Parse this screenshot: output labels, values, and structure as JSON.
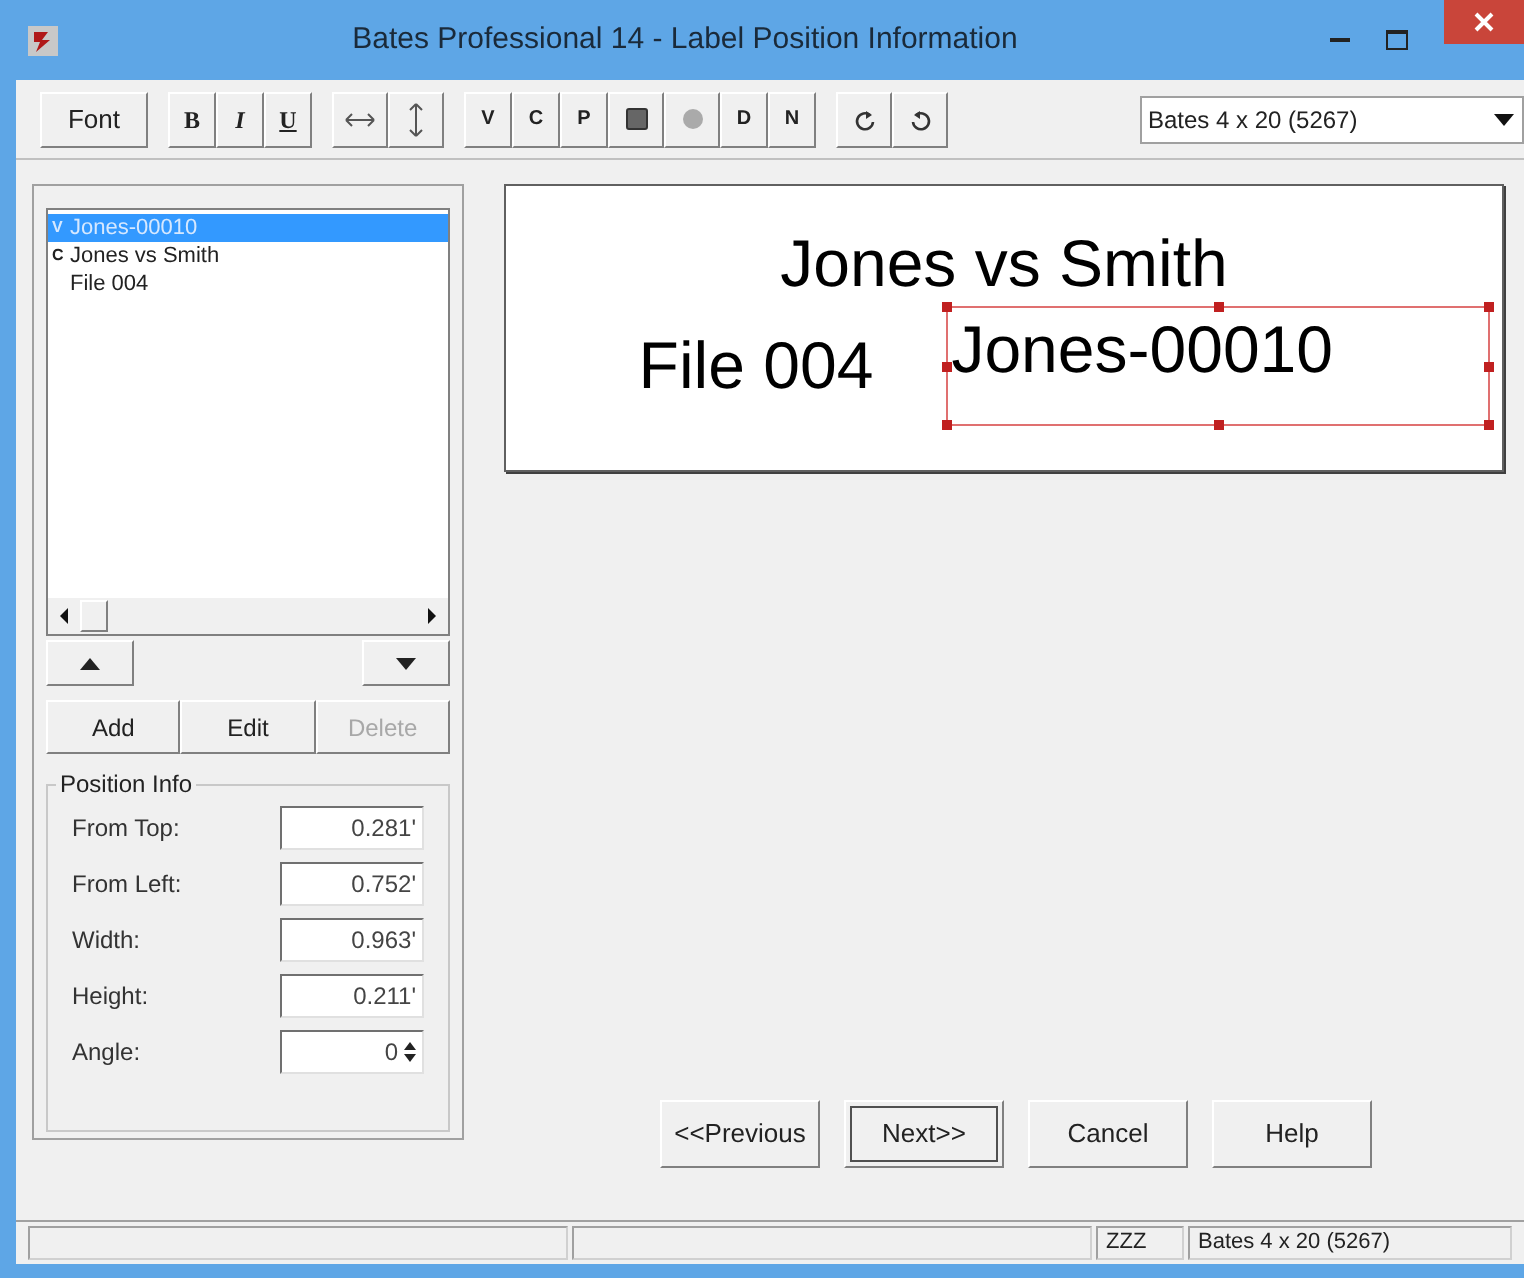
{
  "window": {
    "title": "Bates Professional 14 - Label Position Information"
  },
  "toolbar": {
    "groups": [
      {
        "buttons": [
          {
            "kind": "text",
            "label": "Font"
          }
        ]
      },
      {
        "buttons": [
          {
            "kind": "text",
            "label": "B"
          },
          {
            "kind": "text",
            "label": "I"
          },
          {
            "kind": "text",
            "label": "U"
          }
        ]
      },
      {
        "buttons": [
          {
            "kind": "hresize"
          },
          {
            "kind": "vresize"
          }
        ]
      },
      {
        "buttons": [
          {
            "kind": "text",
            "label": "V"
          },
          {
            "kind": "text",
            "label": "C"
          },
          {
            "kind": "text",
            "label": "P"
          },
          {
            "kind": "square"
          },
          {
            "kind": "dot"
          },
          {
            "kind": "text",
            "label": "D"
          },
          {
            "kind": "text",
            "label": "N"
          }
        ]
      },
      {
        "buttons": [
          {
            "kind": "redo"
          },
          {
            "kind": "undo"
          }
        ]
      }
    ],
    "dropdown": {
      "value": "Bates 4 x 20 (5267)"
    }
  },
  "label_list": {
    "items": [
      {
        "mark": "V",
        "text": "Jones-00010",
        "selected": true
      },
      {
        "mark": "C",
        "text": "Jones vs Smith",
        "selected": false
      },
      {
        "text": "File 004",
        "selected": false
      }
    ]
  },
  "list_buttons": [
    {
      "label": "Add",
      "disabled": false
    },
    {
      "label": "Edit",
      "disabled": false
    },
    {
      "label": "Delete",
      "disabled": true
    }
  ],
  "position_info": {
    "title": "Position Info",
    "fields": [
      {
        "label": "From Top:",
        "value": "0.281'"
      },
      {
        "label": "From Left:",
        "value": "0.752'"
      },
      {
        "label": "Width:",
        "value": "0.963'"
      },
      {
        "label": "Height:",
        "value": "0.211'"
      },
      {
        "label": "Angle:",
        "value": "0",
        "kind": "spin"
      }
    ]
  },
  "preview": {
    "line_1": "Jones vs Smith",
    "line_2_left": "File 004",
    "line_2_right": "Jones-00010"
  },
  "buttons": [
    {
      "label": "<<Previous",
      "default": false
    },
    {
      "label": "Next>>",
      "default": true
    },
    {
      "label": "Cancel",
      "default": false
    },
    {
      "label": "Help",
      "default": false
    }
  ],
  "status_bar": {
    "mode": "ZZZ",
    "label_type": "Bates 4 x 20 (5267)"
  }
}
